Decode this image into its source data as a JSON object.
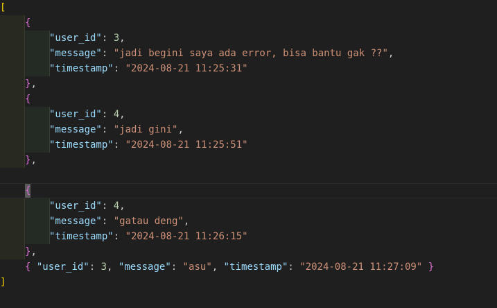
{
  "editor": {
    "open_bracket": "[",
    "close_bracket": "]",
    "open_brace": "{",
    "close_brace": "}",
    "close_brace_comma": ",",
    "colon": ": ",
    "comma": ",",
    "keys": {
      "user_id": "\"user_id\"",
      "message": "\"message\"",
      "timestamp": "\"timestamp\""
    },
    "entries": [
      {
        "user_id": "3",
        "message": "\"jadi begini saya ada error, bisa bantu gak ??\"",
        "timestamp": "\"2024-08-21 11:25:31\""
      },
      {
        "user_id": "4",
        "message": "\"jadi gini\"",
        "timestamp": "\"2024-08-21 11:25:51\""
      },
      {
        "user_id": "4",
        "message": "\"gatau deng\"",
        "timestamp": "\"2024-08-21 11:26:15\""
      }
    ],
    "inline_entry": {
      "user_id": "3",
      "message": "\"asu\"",
      "timestamp": "\"2024-08-21 11:27:09\""
    }
  },
  "colors": {
    "background": "#1f1f1f",
    "key": "#9cdcfe",
    "string": "#ce9178",
    "number": "#b5cea8",
    "bracket_level1": "#ffd700",
    "bracket_level2": "#da70d6"
  }
}
